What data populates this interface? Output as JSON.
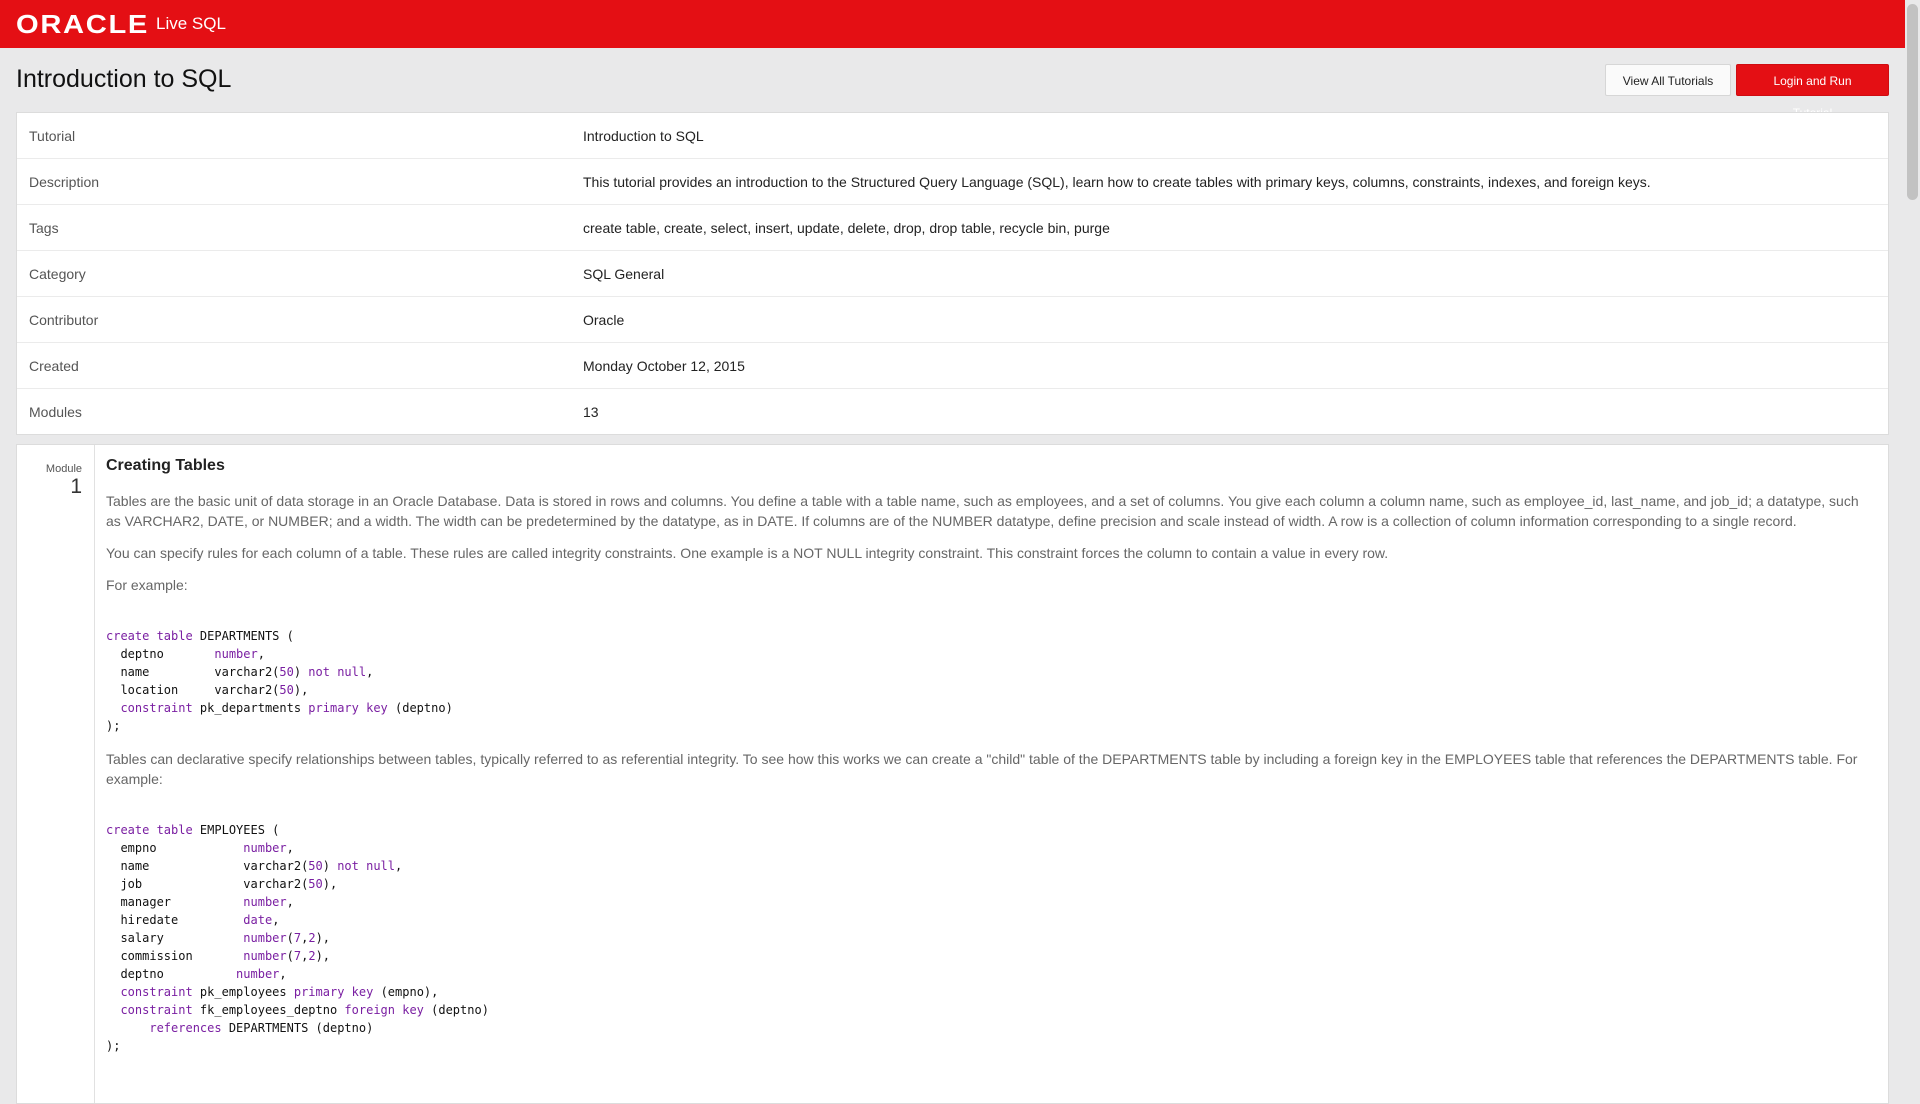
{
  "header": {
    "brand": "ORACLE",
    "product": "Live SQL"
  },
  "page": {
    "title": "Introduction to SQL",
    "view_all_label": "View All Tutorials",
    "login_label": "Login and Run Tutorial"
  },
  "info": [
    {
      "label": "Tutorial",
      "value": "Introduction to SQL"
    },
    {
      "label": "Description",
      "value": "This tutorial provides an introduction to the Structured Query Language (SQL), learn how to create tables with primary keys, columns, constraints, indexes, and foreign keys."
    },
    {
      "label": "Tags",
      "value": "create table, create, select, insert, update, delete, drop, drop table, recycle bin, purge"
    },
    {
      "label": "Category",
      "value": "SQL General"
    },
    {
      "label": "Contributor",
      "value": "Oracle"
    },
    {
      "label": "Created",
      "value": "Monday October 12, 2015"
    },
    {
      "label": "Modules",
      "value": "13"
    }
  ],
  "module": {
    "label": "Module",
    "number": "1",
    "title": "Creating Tables",
    "p1": "Tables are the basic unit of data storage in an Oracle Database. Data is stored in rows and columns. You define a table with a table name, such as employees, and a set of columns. You give each column a column name, such as employee_id, last_name, and job_id; a datatype, such as VARCHAR2, DATE, or NUMBER; and a width. The width can be predetermined by the datatype, as in DATE. If columns are of the NUMBER datatype, define precision and scale instead of width. A row is a collection of column information corresponding to a single record.",
    "p2": "You can specify rules for each column of a table. These rules are called integrity constraints. One example is a NOT NULL integrity constraint. This constraint forces the column to contain a value in every row.",
    "p3": "For example:",
    "p4": "Tables can declarative specify relationships between tables, typically referred to as referential integrity. To see how this works we can create a \"child\" table of the DEPARTMENTS table by including a foreign key in the EMPLOYEES table that references the DEPARTMENTS table. For example:",
    "code1": [
      [
        "create table",
        " DEPARTMENTS ("
      ],
      [
        "",
        "  deptno       ",
        "number",
        ","
      ],
      [
        "",
        "  name         varchar2(",
        "50",
        ") ",
        "not null",
        ","
      ],
      [
        "",
        "  location     varchar2(",
        "50",
        "),"
      ],
      [
        "",
        "  ",
        "constraint",
        " pk_departments ",
        "primary key",
        " (deptno)"
      ],
      [
        "",
        ");"
      ]
    ],
    "code2": [
      [
        "create table",
        " EMPLOYEES ("
      ],
      [
        "",
        "  empno            ",
        "number",
        ","
      ],
      [
        "",
        "  name             varchar2(",
        "50",
        ") ",
        "not null",
        ","
      ],
      [
        "",
        "  job              varchar2(",
        "50",
        "),"
      ],
      [
        "",
        "  manager          ",
        "number",
        ","
      ],
      [
        "",
        "  hiredate         ",
        "date",
        ","
      ],
      [
        "",
        "  salary           ",
        "number",
        "(",
        "7",
        ",",
        "2",
        "),"
      ],
      [
        "",
        "  commission       ",
        "number",
        "(",
        "7",
        ",",
        "2",
        "),"
      ],
      [
        "",
        "  deptno          ",
        "number",
        ","
      ],
      [
        "",
        "  ",
        "constraint",
        " pk_employees ",
        "primary key",
        " (empno),"
      ],
      [
        "",
        "  ",
        "constraint",
        " fk_employees_deptno ",
        "foreign key",
        " (deptno)"
      ],
      [
        "",
        "      ",
        "references",
        " DEPARTMENTS (deptno)"
      ],
      [
        "",
        ");"
      ]
    ]
  }
}
